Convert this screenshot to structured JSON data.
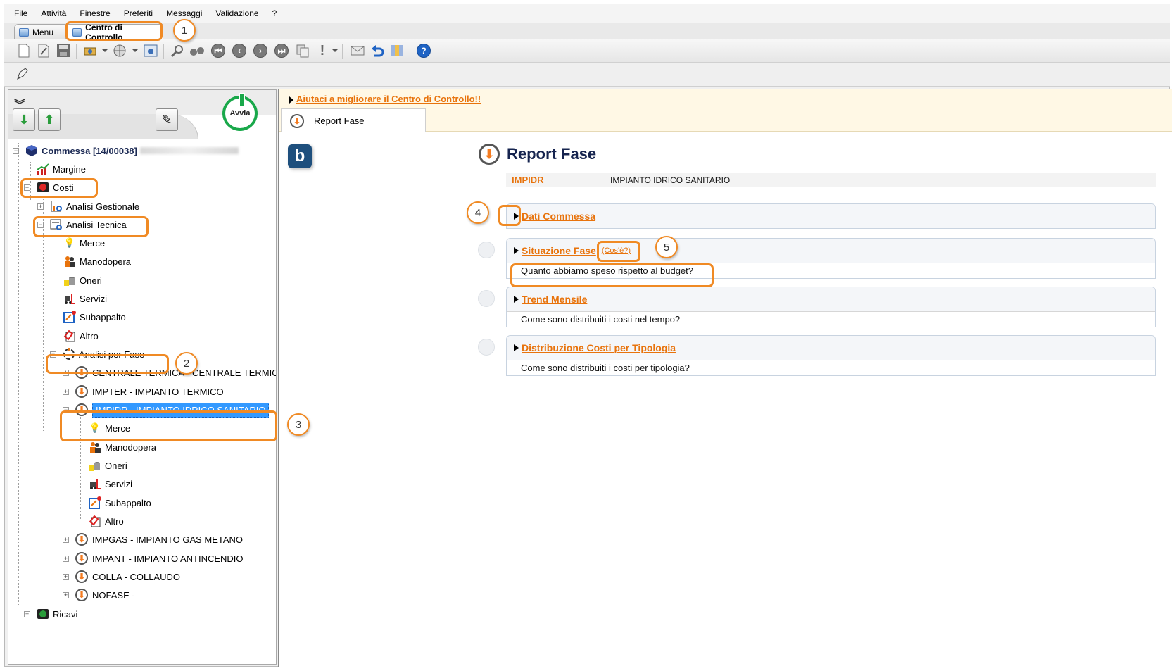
{
  "menu": [
    "File",
    "Attività",
    "Finestre",
    "Preferiti",
    "Messaggi",
    "Validazione",
    "?"
  ],
  "window_tabs": [
    {
      "label": "Menu"
    },
    {
      "label": "Centro di Controllo"
    }
  ],
  "toolbar_icons": [
    "new-document-icon",
    "edit-document-icon",
    "save-icon",
    "tools-icon",
    "globe-icon",
    "settings-icon",
    "search-icon",
    "binoculars-icon",
    "first-icon",
    "previous-icon",
    "next-icon",
    "last-icon",
    "copy-icon",
    "alert-icon",
    "mail-icon",
    "undo-icon",
    "filter-icon",
    "help-icon"
  ],
  "left_panel": {
    "avvia_label": "Avvia",
    "tree": {
      "root": "Commessa [14/00038]",
      "margine": "Margine",
      "costi": "Costi",
      "analisi_gestionale": "Analisi Gestionale",
      "analisi_tecnica": "Analisi Tecnica",
      "tecnica_children": [
        "Merce",
        "Manodopera",
        "Oneri",
        "Servizi",
        "Subappalto",
        "Altro"
      ],
      "analisi_per_fase": "Analisi per Fase",
      "fasi_top": [
        "CENTRALE TERMICA - CENTRALE TERMIC",
        "IMPTER - IMPIANTO TERMICO"
      ],
      "fase_selected": "IMPIDR - IMPIANTO IDRICO SANITARIO",
      "fase_children": [
        "Merce",
        "Manodopera",
        "Oneri",
        "Servizi",
        "Subappalto",
        "Altro"
      ],
      "fasi_bottom": [
        "IMPGAS - IMPIANTO GAS METANO",
        "IMPANT - IMPIANTO ANTINCENDIO",
        "COLLA - COLLAUDO",
        "NOFASE -"
      ],
      "ricavi": "Ricavi"
    }
  },
  "right_panel": {
    "banner_link": "Aiutaci a migliorare il Centro di Controllo!!",
    "tab_label": "Report Fase",
    "logo_letter": "b",
    "title": "Report Fase",
    "code": "IMPIDR",
    "code_description": "IMPIANTO IDRICO SANITARIO",
    "sections": [
      {
        "title": "Dati Commessa",
        "question": ""
      },
      {
        "title": "Situazione Fase",
        "cose": "(Cos'è?)",
        "question": "Quanto abbiamo speso rispetto al budget?"
      },
      {
        "title": "Trend Mensile",
        "question": "Come sono distribuiti i costi nel tempo?"
      },
      {
        "title": "Distribuzione Costi per Tipologia",
        "question": "Come sono distribuiti i costi per tipologia?"
      }
    ]
  },
  "callouts": [
    "1",
    "2",
    "3",
    "4",
    "5"
  ],
  "colors": {
    "accent_orange": "#f08a24",
    "link_orange": "#e8730c",
    "selection": "#3399ff",
    "title_navy": "#16244f"
  }
}
